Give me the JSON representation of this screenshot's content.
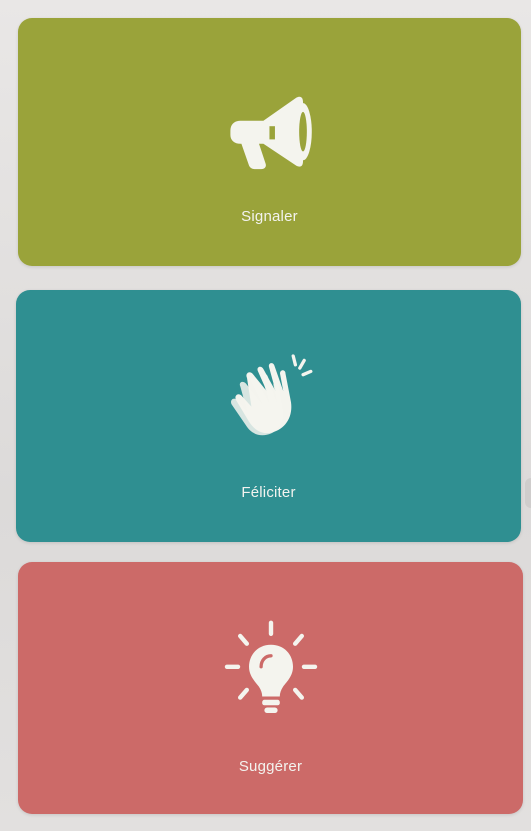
{
  "cards": [
    {
      "label": "Signaler",
      "icon": "megaphone-icon",
      "color": "#9aa33a"
    },
    {
      "label": "Féliciter",
      "icon": "clapping-hands-icon",
      "color": "#2f8f91"
    },
    {
      "label": "Suggérer",
      "icon": "lightbulb-icon",
      "color": "#cc6a68"
    }
  ]
}
